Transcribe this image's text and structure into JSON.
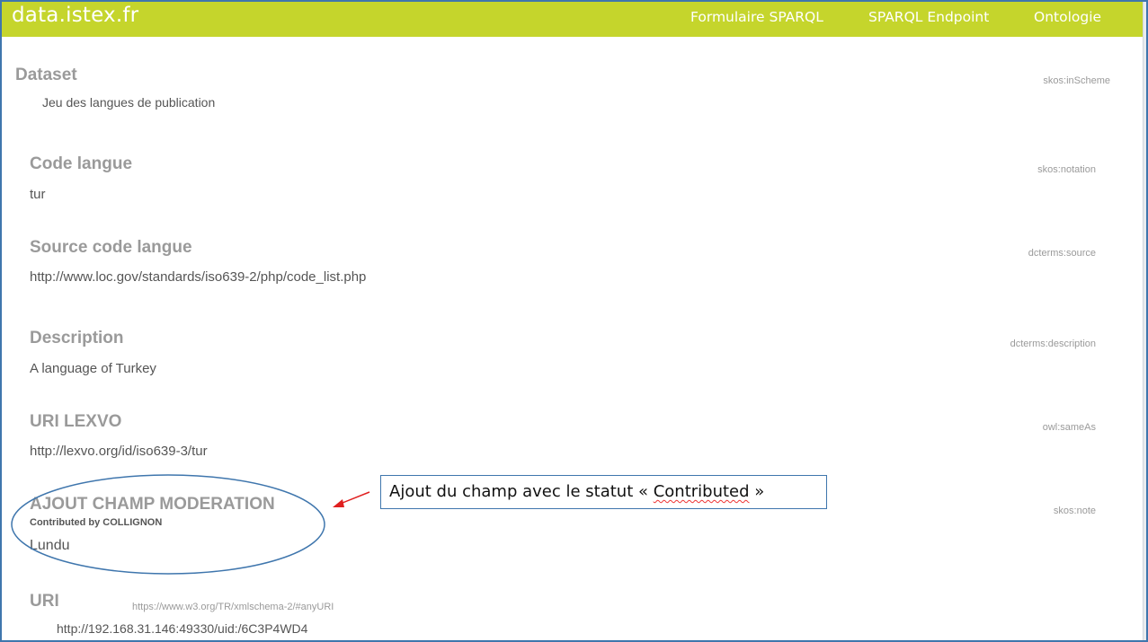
{
  "navbar": {
    "brand": "data.istex.fr",
    "links": [
      "Formulaire SPARQL",
      "SPARQL Endpoint",
      "Ontologie"
    ]
  },
  "dataset": {
    "label": "Dataset",
    "value": "Jeu des langues de publication",
    "prop": "skos:inScheme"
  },
  "fields": [
    {
      "label": "Code langue",
      "value": "tur",
      "prop": "skos:notation"
    },
    {
      "label": "Source code langue",
      "value": "http://www.loc.gov/standards/iso639-2/php/code_list.php",
      "prop": "dcterms:source"
    },
    {
      "label": "Description",
      "value": "A language of Turkey",
      "prop": "dcterms:description"
    },
    {
      "label": "URI LEXVO",
      "value": "http://lexvo.org/id/iso639-3/tur",
      "prop": "owl:sameAs"
    },
    {
      "label": "AJOUT CHAMP MODERATION",
      "contributed": "Contributed by COLLIGNON",
      "value": "Lundu",
      "prop": "skos:note"
    }
  ],
  "uri": {
    "label": "URI",
    "datatype": "https://www.w3.org/TR/xmlschema-2/#anyURI",
    "value": "http://192.168.31.146:49330/uid:/6C3P4WD4"
  },
  "annotation": {
    "text_before": "Ajout du champ avec le statut « ",
    "text_highlight": "Contributed",
    "text_after": " »",
    "color": "#3f76ad",
    "arrow_color": "#e02020"
  }
}
